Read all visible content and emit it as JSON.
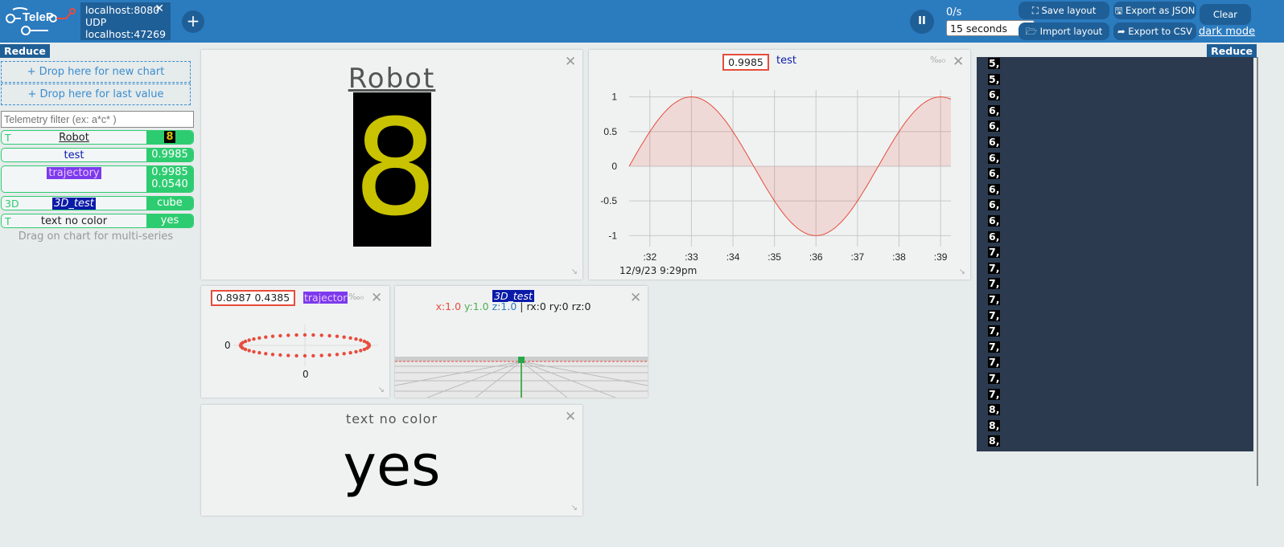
{
  "header": {
    "connection": {
      "line1": "localhost:8080",
      "line2": "UDP",
      "line3": "localhost:47269",
      "close": "✕"
    },
    "add_label": "+",
    "pause_label": "II",
    "rate": "0/s",
    "time_window": "15 seconds",
    "buttons": {
      "save": "⛶ Save layout",
      "export_json": "🖫 Export as JSON",
      "clear": "Clear",
      "import": "🗁 Import layout",
      "export_csv": "➦ Export to CSV"
    },
    "dark_mode": "dark mode"
  },
  "reduce_label": "Reduce",
  "sidebar": {
    "drop_new": "+ Drop here for new chart",
    "drop_last": "+ Drop here for last value",
    "filter_placeholder": "Telemetry filter (ex: a*c* )",
    "items": [
      {
        "type": "T",
        "name": "Robot",
        "value": "8",
        "value2": ""
      },
      {
        "type": "",
        "name": "test",
        "value": "0.9985",
        "value2": ""
      },
      {
        "type": "",
        "name": "trajectory",
        "value": "0.9985",
        "value2": "0.0540"
      },
      {
        "type": "3D",
        "name": "3D_test",
        "value": "cube",
        "value2": ""
      },
      {
        "type": "T",
        "name": "text no color",
        "value": "yes",
        "value2": ""
      }
    ],
    "hint": "Drag on chart for multi-series"
  },
  "panels": {
    "robot": {
      "title": "Robot",
      "value": "8",
      "close": "✕"
    },
    "test": {
      "value": "0.9985",
      "name": "test",
      "permil": "‰₀",
      "close": "✕",
      "date": "12/9/23 9:29pm",
      "chart_data": {
        "type": "area",
        "xticks": [
          ":32",
          ":33",
          ":34",
          ":35",
          ":36",
          ":37",
          ":38",
          ":39"
        ],
        "yticks": [
          "1",
          "0.5",
          "0",
          "-0.5",
          "-1"
        ],
        "ylim": [
          -1.1,
          1.1
        ],
        "series": [
          {
            "name": "test",
            "color": "#e74c3c",
            "points": [
              [
                31.5,
                0.0
              ],
              [
                32.0,
                0.5
              ],
              [
                32.5,
                0.87
              ],
              [
                33.0,
                1.0
              ],
              [
                33.5,
                0.87
              ],
              [
                34.0,
                0.5
              ],
              [
                34.5,
                0.0
              ],
              [
                35.0,
                -0.5
              ],
              [
                35.5,
                -0.87
              ],
              [
                36.0,
                -1.0
              ],
              [
                36.5,
                -0.87
              ],
              [
                37.0,
                -0.5
              ],
              [
                37.5,
                0.0
              ],
              [
                38.0,
                0.5
              ],
              [
                38.5,
                0.87
              ],
              [
                39.0,
                1.0
              ]
            ]
          }
        ]
      }
    },
    "trajectory": {
      "value": "0.8987 0.4385",
      "name": "trajector",
      "permil": "‰₀",
      "close": "✕",
      "ylabel": "0",
      "xlabel": "0",
      "chart_data": {
        "type": "scatter",
        "series": [
          {
            "name": "trajectory",
            "color": "#e74c3c",
            "shape": "ellipse",
            "points": 48
          }
        ]
      }
    },
    "test3d": {
      "name": "3D_test",
      "x": "x:1.0",
      "y": "y:1.0",
      "z": "z:1.0",
      "sep": "|",
      "rot": "rx:0 ry:0 rz:0",
      "close": "✕"
    },
    "text": {
      "title": "text no color",
      "value": "yes",
      "close": "✕"
    }
  },
  "log": [
    "5,",
    "5,",
    "6,",
    "6,",
    "6,",
    "6,",
    "6,",
    "6,",
    "6,",
    "6,",
    "6,",
    "6,",
    "7,",
    "7,",
    "7,",
    "7,",
    "7,",
    "7,",
    "7,",
    "7,",
    "7,",
    "7,",
    "8,",
    "8,",
    "8,"
  ],
  "colors": {
    "accent": "#2b7bbf",
    "green": "#2ecc71",
    "red": "#e74c3c",
    "purple": "#7c3aed",
    "navy": "#0a1aa8"
  }
}
